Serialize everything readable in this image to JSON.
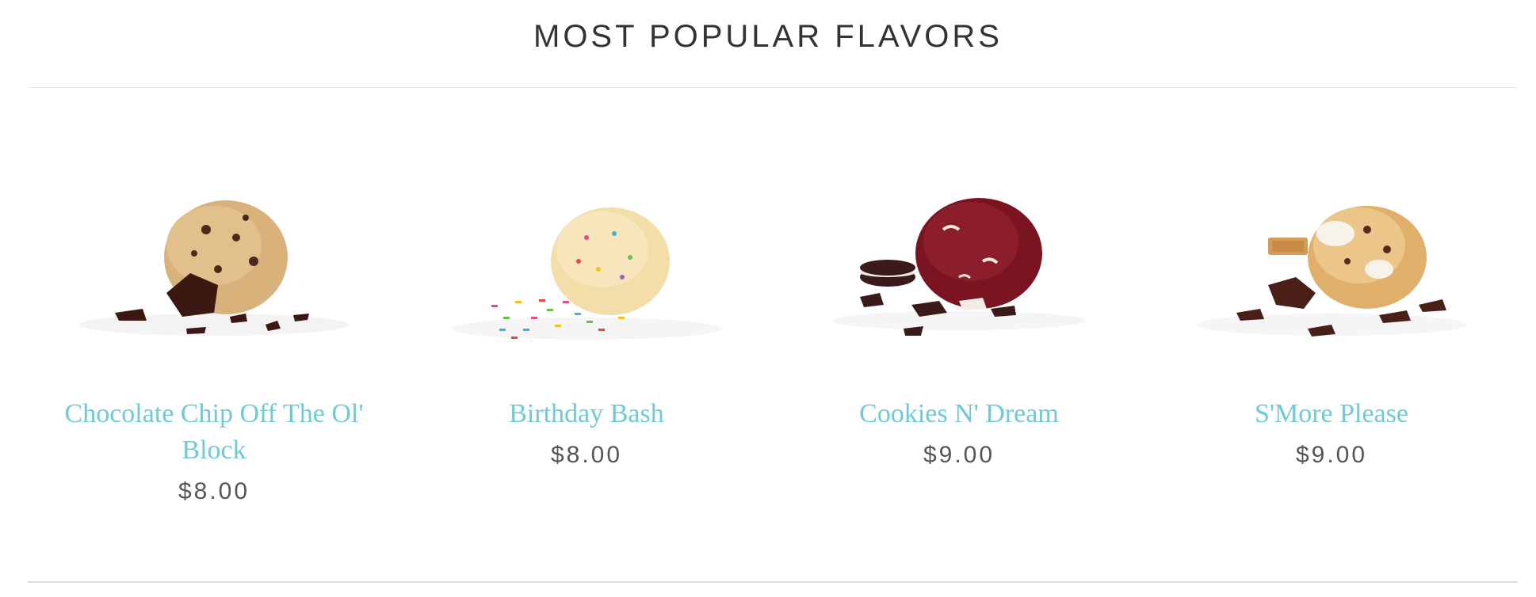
{
  "section": {
    "title": "MOST POPULAR FLAVORS"
  },
  "products": [
    {
      "name": "Chocolate Chip Off The Ol' Block",
      "price": "$8.00",
      "image_icon": "chocolate-chip-dough-scoop"
    },
    {
      "name": "Birthday Bash",
      "price": "$8.00",
      "image_icon": "birthday-sprinkles-dough-scoop"
    },
    {
      "name": "Cookies N' Dream",
      "price": "$9.00",
      "image_icon": "red-velvet-cookies-dough-scoop"
    },
    {
      "name": "S'More Please",
      "price": "$9.00",
      "image_icon": "smores-dough-scoop"
    }
  ],
  "colors": {
    "link": "#6ccbd7",
    "title": "#333333",
    "price": "#555555"
  }
}
